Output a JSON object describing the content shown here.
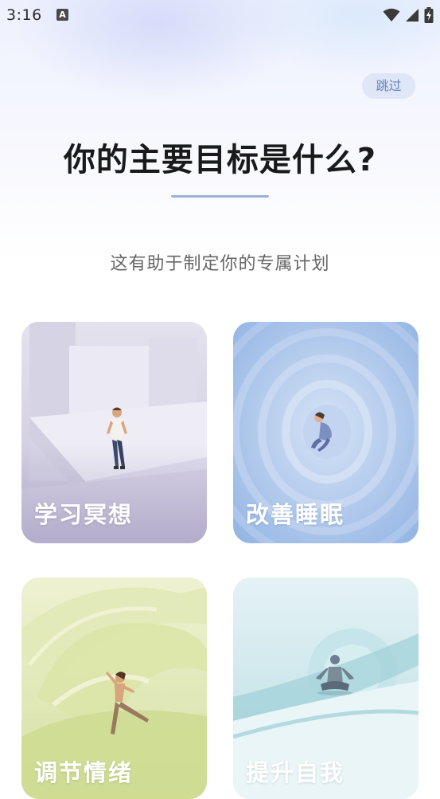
{
  "status_bar": {
    "time": "3:16",
    "notification_icon": "A",
    "icons": [
      "wifi-icon",
      "signal-icon",
      "battery-charging-icon"
    ]
  },
  "skip_label": "跳过",
  "title": "你的主要目标是什么?",
  "subtitle": "这有助于制定你的专属计划",
  "goals": [
    {
      "label": "学习冥想",
      "illustration": "person-sitting-on-ledge"
    },
    {
      "label": "改善睡眠",
      "illustration": "person-curled-in-circles"
    },
    {
      "label": "调节情绪",
      "illustration": "person-dancing"
    },
    {
      "label": "提升自我",
      "illustration": "person-meditating"
    }
  ],
  "colors": {
    "title": "#1a1a1a",
    "subtitle": "#666666",
    "skip_bg": "#dfe6f8",
    "skip_text": "#6b82b9",
    "underline": "#9fb0d8",
    "card_label": "#ffffff"
  }
}
